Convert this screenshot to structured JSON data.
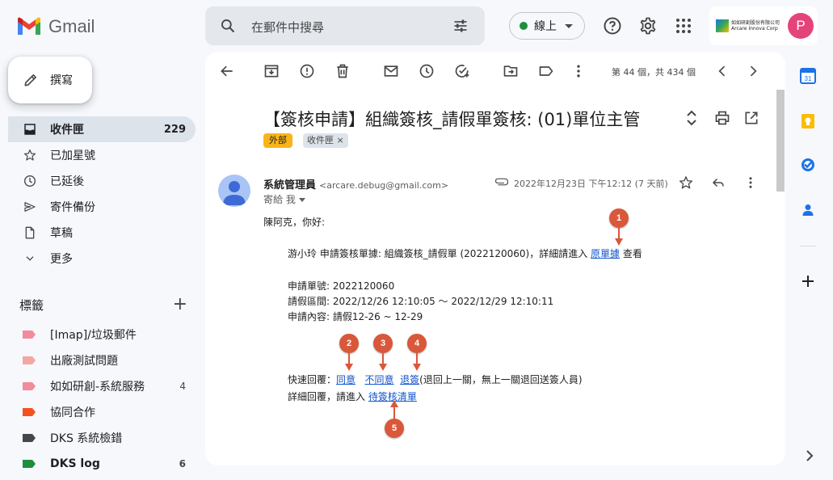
{
  "app": {
    "name": "Gmail"
  },
  "search": {
    "placeholder": "在郵件中搜尋"
  },
  "status": {
    "label": "線上"
  },
  "account": {
    "org_name_line1": "如如研創股份有限公司",
    "org_name_line2": "Arcare Innova Corp",
    "avatar_letter": "P",
    "avatar_color": "#e5447a"
  },
  "compose": {
    "label": "撰寫"
  },
  "nav": {
    "items": [
      {
        "label": "收件匣",
        "count": "229",
        "icon": "inbox-icon"
      },
      {
        "label": "已加星號",
        "icon": "star-icon"
      },
      {
        "label": "已延後",
        "icon": "clock-icon"
      },
      {
        "label": "寄件備份",
        "icon": "send-icon"
      },
      {
        "label": "草稿",
        "icon": "draft-icon"
      },
      {
        "label": "更多",
        "icon": "chevron-down-icon"
      }
    ]
  },
  "labels": {
    "header": "標籤",
    "items": [
      {
        "label": "[Imap]/垃圾郵件",
        "color": "#f28b9c"
      },
      {
        "label": "出廠測試問題",
        "color": "#f4a7a0"
      },
      {
        "label": "如如研創-系統服務",
        "count": "4",
        "color": "#f28b9c"
      },
      {
        "label": "協同合作",
        "color": "#f4511e"
      },
      {
        "label": "DKS 系統檢錯",
        "color": "#444746"
      },
      {
        "label": "DKS log",
        "count": "6",
        "color": "#1e8e3e"
      }
    ]
  },
  "toolbar": {
    "paging": "第 44 個，共 434 個"
  },
  "email": {
    "subject": "【簽核申請】組織簽核_請假單簽核: (01)單位主管",
    "tags": {
      "external": "外部",
      "inbox": "收件匣"
    },
    "sender_name": "系統管理員",
    "sender_email": "<arcare.debug@gmail.com>",
    "to": "寄給 我",
    "date": "2022年12月23日 下午12:12 (7 天前)",
    "greeting": "陳阿克，你好:",
    "line1_prefix": "游小玲 申請簽核單據: 組織簽核_請假單 (2022120060)，詳細請進入",
    "line1_link": "原單據",
    "line1_suffix": "查看",
    "doc_no": "申請單號: 2022120060",
    "period": "請假區間: 2022/12/26 12:10:05 ～ 2022/12/29 12:10:11",
    "content": "申請內容: 請假12-26 ~ 12-29",
    "quick_reply_prefix": "快速回覆：",
    "quick_agree": "同意",
    "quick_disagree": "不同意",
    "quick_return": "退簽",
    "quick_return_note": "(退回上一關，無上一關退回送簽人員)",
    "detail_prefix": "詳細回覆，請進入",
    "detail_link": "待簽核清單"
  },
  "markers": [
    "1",
    "2",
    "3",
    "4",
    "5"
  ],
  "colors": {
    "marker": "#d9573a",
    "link": "#1155cc",
    "active_nav": "#dde3ea"
  }
}
